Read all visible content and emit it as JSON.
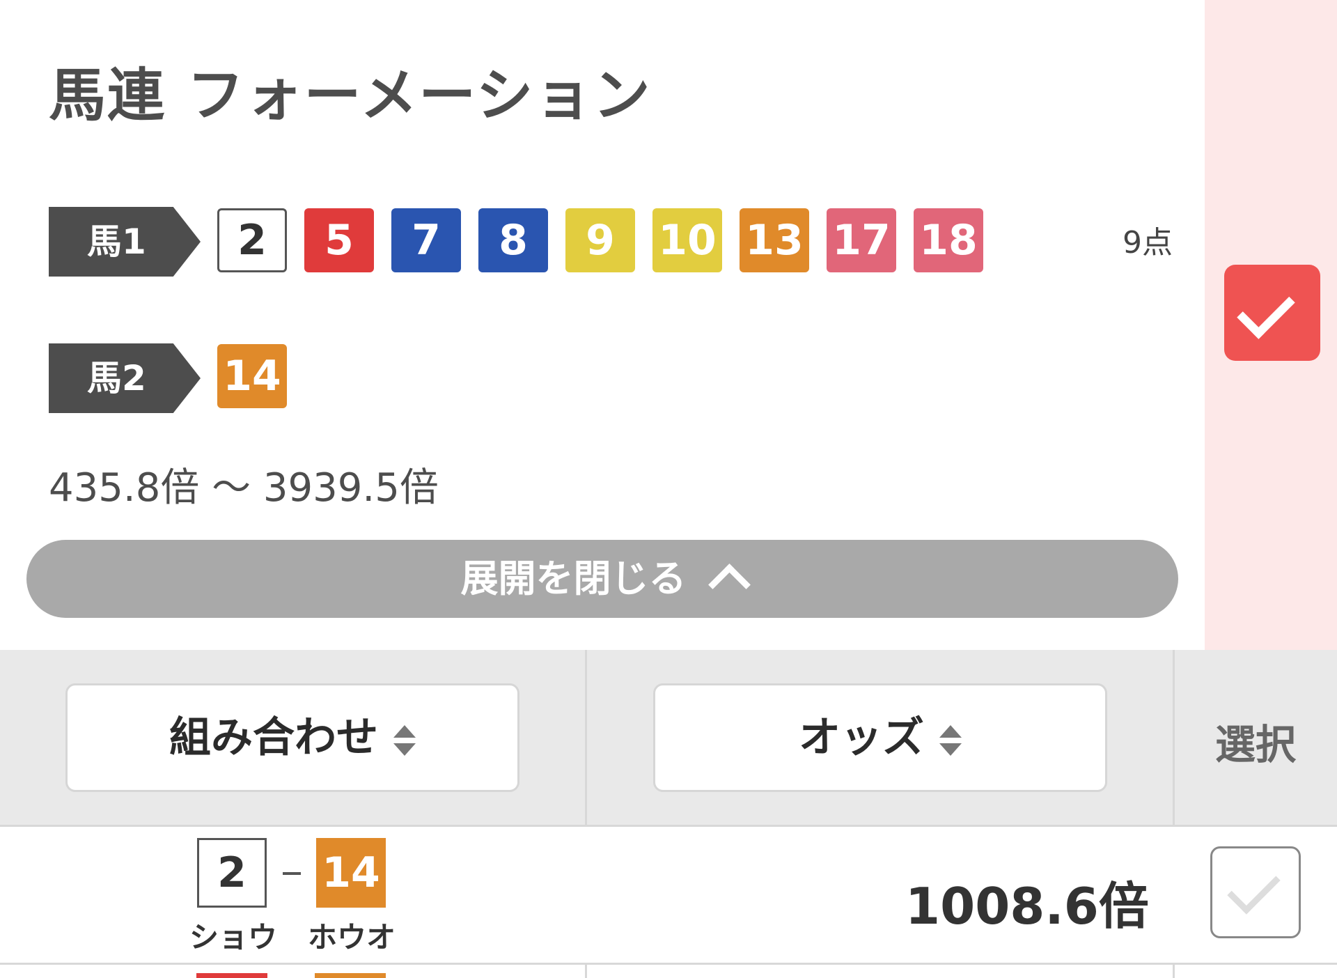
{
  "header": {
    "title": "馬連 フォーメーション"
  },
  "horse1": {
    "label": "馬1",
    "numbers": [
      "2",
      "5",
      "7",
      "8",
      "9",
      "10",
      "13",
      "17",
      "18"
    ]
  },
  "horse2": {
    "label": "馬2",
    "numbers": [
      "14"
    ]
  },
  "points": "9点",
  "odds_range": "435.8倍 ～ 3939.5倍",
  "collapse_label": "展開を閉じる",
  "table": {
    "headers": {
      "combination": "組み合わせ",
      "odds": "オッズ",
      "select": "選択"
    },
    "rows": [
      {
        "first": "2",
        "first_kana": "ショウ",
        "second": "14",
        "second_kana": "ホウオ",
        "odds": "1008.6倍",
        "selected": false
      }
    ]
  },
  "colors": {
    "accent_red": "#ef5352",
    "side_panel": "#fde8e8",
    "button_gray": "#a9a9a9"
  },
  "icons": {
    "selected_check": "check-icon",
    "collapse": "chevron-up-icon",
    "sort": "sort-icon"
  }
}
